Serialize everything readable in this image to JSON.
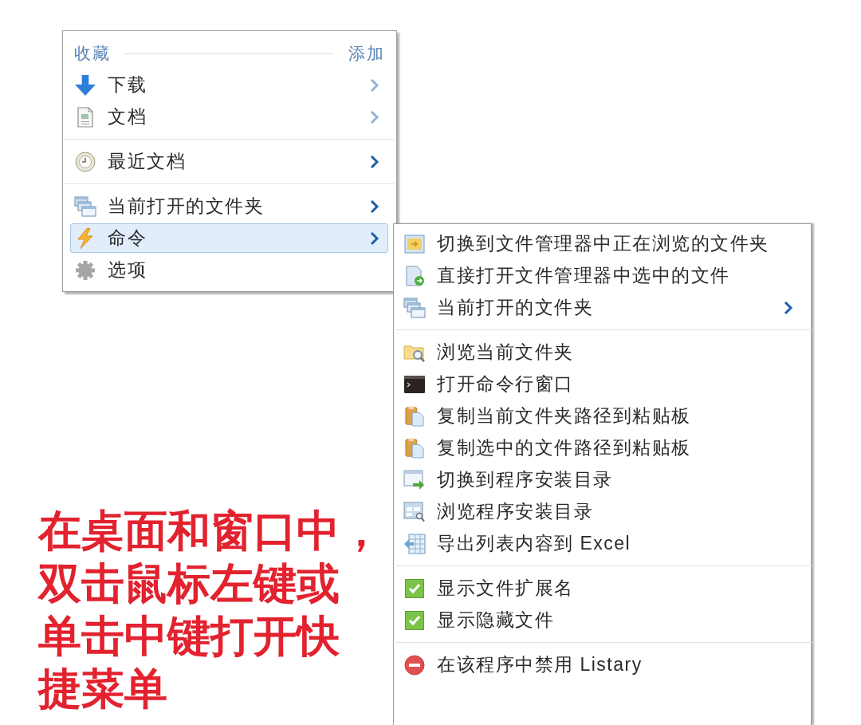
{
  "favorites_menu": {
    "title": "收藏",
    "add_link": "添加",
    "groups": [
      [
        {
          "label": "下载",
          "has_submenu": true,
          "selected": false
        },
        {
          "label": "文档",
          "has_submenu": true,
          "selected": false
        }
      ],
      [
        {
          "label": "最近文档",
          "has_submenu": true,
          "selected": false
        }
      ],
      [
        {
          "label": "当前打开的文件夹",
          "has_submenu": true,
          "selected": false
        },
        {
          "label": "命令",
          "has_submenu": true,
          "selected": true
        },
        {
          "label": "选项",
          "has_submenu": false,
          "selected": false
        }
      ]
    ]
  },
  "command_submenu": {
    "groups": [
      [
        {
          "kind": "command",
          "label": "切换到文件管理器中正在浏览的文件夹",
          "has_submenu": false,
          "selected": false
        },
        {
          "kind": "command",
          "label": "直接打开文件管理器中选中的文件",
          "has_submenu": false,
          "selected": false
        },
        {
          "kind": "command",
          "label": "当前打开的文件夹",
          "has_submenu": true,
          "selected": false
        }
      ],
      [
        {
          "kind": "command",
          "label": "浏览当前文件夹",
          "has_submenu": false,
          "selected": false
        },
        {
          "kind": "command",
          "label": "打开命令行窗口",
          "has_submenu": false,
          "selected": false
        },
        {
          "kind": "command",
          "label": "复制当前文件夹路径到粘贴板",
          "has_submenu": false,
          "selected": false
        },
        {
          "kind": "command",
          "label": "复制选中的文件路径到粘贴板",
          "has_submenu": false,
          "selected": false
        },
        {
          "kind": "command",
          "label": "切换到程序安装目录",
          "has_submenu": false,
          "selected": false
        },
        {
          "kind": "command",
          "label": "浏览程序安装目录",
          "has_submenu": false,
          "selected": false
        },
        {
          "kind": "command",
          "label": "导出列表内容到 Excel",
          "has_submenu": false,
          "selected": false
        }
      ],
      [
        {
          "kind": "checkbox",
          "label": "显示文件扩展名",
          "checked": true,
          "has_submenu": false,
          "selected": false
        },
        {
          "kind": "checkbox",
          "label": "显示隐藏文件",
          "checked": true,
          "has_submenu": false,
          "selected": false
        }
      ],
      [
        {
          "kind": "command",
          "label": "在该程序中禁用 Listary",
          "has_submenu": false,
          "selected": false
        }
      ]
    ]
  },
  "caption": {
    "lines": [
      "在桌面和窗口中，",
      "双击鼠标左键或",
      "单击中键打开快",
      "捷菜单"
    ]
  }
}
